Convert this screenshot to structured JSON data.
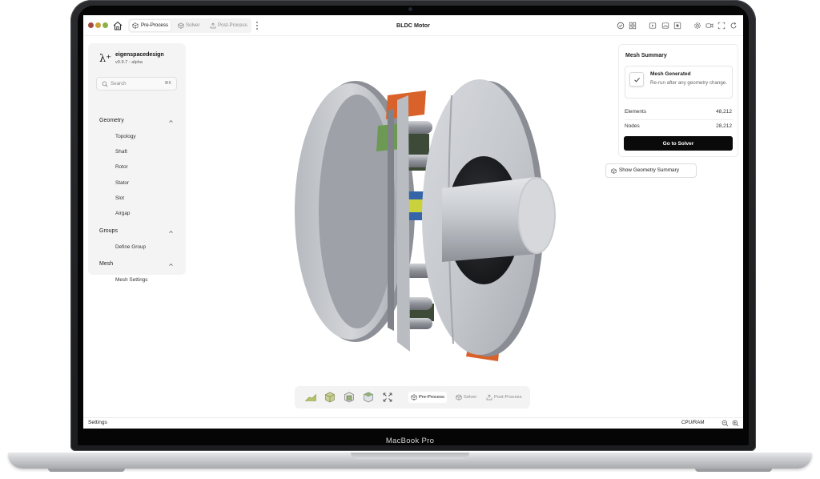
{
  "device": {
    "label": "MacBook Pro"
  },
  "window": {
    "title": "BLDC Motor",
    "traffic_colors": [
      "#a44b3c",
      "#c9a23a",
      "#8db04a"
    ]
  },
  "workflow_tabs": [
    {
      "label": "Pre-Process",
      "icon": "cube-icon",
      "active": true
    },
    {
      "label": "Solver",
      "icon": "solver-cube-icon",
      "active": false
    },
    {
      "label": "Post-Process",
      "icon": "export-icon",
      "active": false
    }
  ],
  "toolbar_icons": [
    "check-circle-icon",
    "grid-icon",
    "play-icon",
    "image-icon",
    "stop-icon",
    "gear-icon",
    "camera-icon",
    "fullscreen-icon",
    "refresh-icon"
  ],
  "sidebar": {
    "logo_mark": "λ⁺",
    "app_name": "eigenspacedesign",
    "version": "v0.9.7 - alpha",
    "search_placeholder": "Search",
    "search_shortcut": "⌘K",
    "sections": [
      {
        "title": "Geometry",
        "items": [
          "Topology",
          "Shaft",
          "Rotor",
          "Stator",
          "Slot",
          "Airgap"
        ]
      },
      {
        "title": "Groups",
        "items": [
          "Define Group"
        ]
      },
      {
        "title": "Mesh",
        "items": [
          "Mesh Settings"
        ]
      }
    ]
  },
  "mesh_summary": {
    "title": "Mesh Summary",
    "status_title": "Mesh Generated",
    "status_body": "Re-run after any geometry change.",
    "checked": true,
    "metrics": [
      {
        "label": "Elements",
        "value": "48,212"
      },
      {
        "label": "Nodes",
        "value": "28,212"
      }
    ],
    "button_label": "Go to Solver"
  },
  "geometry_summary_button": "Show Geometry Summary",
  "viewport": {
    "model": "bldc-motor-3d",
    "colors": {
      "metal": "#c9ccd1",
      "accent_orange": "#d9622b",
      "accent_green": "#6c9a55",
      "accent_blue": "#3565a8",
      "accent_yellow": "#c9d23c"
    }
  },
  "view_tools": [
    "view-solid-icon",
    "view-front-icon",
    "view-box-icon",
    "view-iso-icon",
    "fit-view-icon"
  ],
  "bottom_tabs": [
    {
      "label": "Pre-Process",
      "active": true
    },
    {
      "label": "Solver",
      "active": false
    },
    {
      "label": "Post-Process",
      "active": false
    }
  ],
  "statusbar": {
    "left": "Settings",
    "right": "CPU/RAM"
  }
}
